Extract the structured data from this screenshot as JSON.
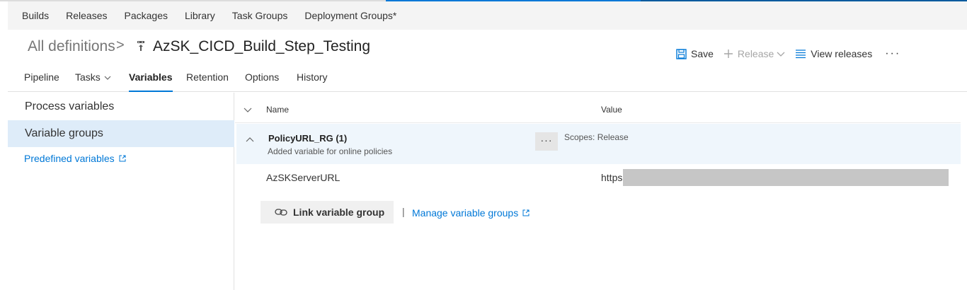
{
  "hub_nav": [
    {
      "label": "Builds"
    },
    {
      "label": "Releases"
    },
    {
      "label": "Packages"
    },
    {
      "label": "Library"
    },
    {
      "label": "Task Groups"
    },
    {
      "label": "Deployment Groups*"
    }
  ],
  "breadcrumb": {
    "root": "All definitions",
    "separator": ">",
    "definition_icon": "build-definition-icon",
    "title": "AzSK_CICD_Build_Step_Testing"
  },
  "actions": {
    "save_label": "Save",
    "release_label": "Release",
    "view_releases_label": "View releases",
    "more_label": "···"
  },
  "tabs": [
    {
      "label": "Pipeline"
    },
    {
      "label": "Tasks"
    },
    {
      "label": "Variables",
      "active": true
    },
    {
      "label": "Retention"
    },
    {
      "label": "Options"
    },
    {
      "label": "History"
    }
  ],
  "left_pane": {
    "process_variables": "Process variables",
    "variable_groups": "Variable groups",
    "predefined_variables": "Predefined variables"
  },
  "table": {
    "col_name": "Name",
    "col_value": "Value"
  },
  "group": {
    "name": "PolicyURL_RG (1)",
    "description": "Added variable for online policies",
    "more_label": "···",
    "scopes": "Scopes: Release"
  },
  "variables": [
    {
      "name": "AzSKServerURL",
      "value": "https"
    }
  ],
  "link_button": "Link variable group",
  "separator": "|",
  "manage_link": "Manage variable groups",
  "colors": {
    "accent": "#0078d7",
    "selected_bg": "#deecf9",
    "group_bg": "#eff6fc",
    "redacted": "#c6c6c6"
  }
}
